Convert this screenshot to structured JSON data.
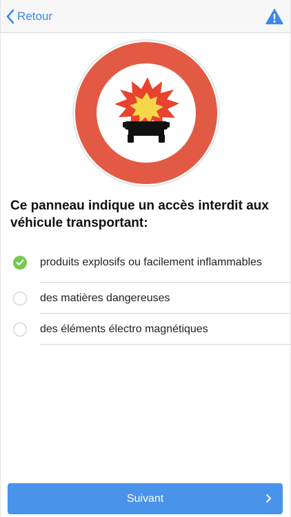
{
  "nav": {
    "back_label": "Retour",
    "back_icon": "chevron-left-icon",
    "warning_icon": "warning-triangle-icon"
  },
  "sign": {
    "icon": "no-explosive-vehicles-sign",
    "ring_color": "#e25a43",
    "flame_color": "#e8432e",
    "burst_color": "#f7d64a"
  },
  "question": "Ce panneau indique un accès interdit aux véhicule transportant:",
  "options": [
    {
      "label": "produits explosifs ou facilement inflammables",
      "selected": true
    },
    {
      "label": "des matières dangereuses",
      "selected": false
    },
    {
      "label": "des éléments électro magnétiques",
      "selected": false
    }
  ],
  "next_button": {
    "label": "Suivant",
    "icon": "chevron-right-icon"
  },
  "colors": {
    "accent": "#3b87e8",
    "button": "#4a93ea",
    "selected": "#76c852"
  }
}
